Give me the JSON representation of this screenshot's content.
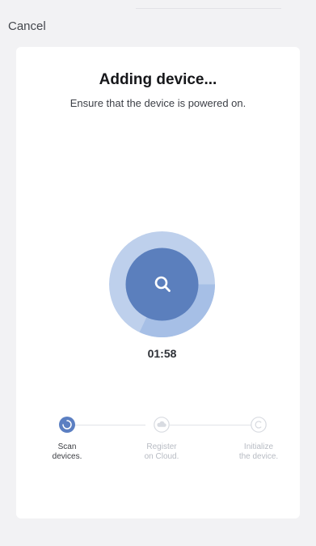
{
  "header": {
    "cancel_label": "Cancel"
  },
  "card": {
    "title": "Adding device...",
    "subtitle": "Ensure that the device is powered on."
  },
  "progress": {
    "timer": "01:58",
    "ring_fraction": 0.32,
    "center_icon": "search-icon"
  },
  "steps": [
    {
      "label": "Scan\ndevices.",
      "icon": "scan-spinner-icon",
      "state": "active"
    },
    {
      "label": "Register\non Cloud.",
      "icon": "cloud-icon",
      "state": "pending"
    },
    {
      "label": "Initialize\nthe device.",
      "icon": "initialize-icon",
      "state": "pending"
    }
  ],
  "colors": {
    "ring_light": "#bed0ec",
    "ring_mid": "#a6bfe6",
    "ring_dark": "#5b7fbd",
    "active_step": "#5b7fc2",
    "inactive": "#d8dbe1",
    "background": "#f2f2f4"
  }
}
